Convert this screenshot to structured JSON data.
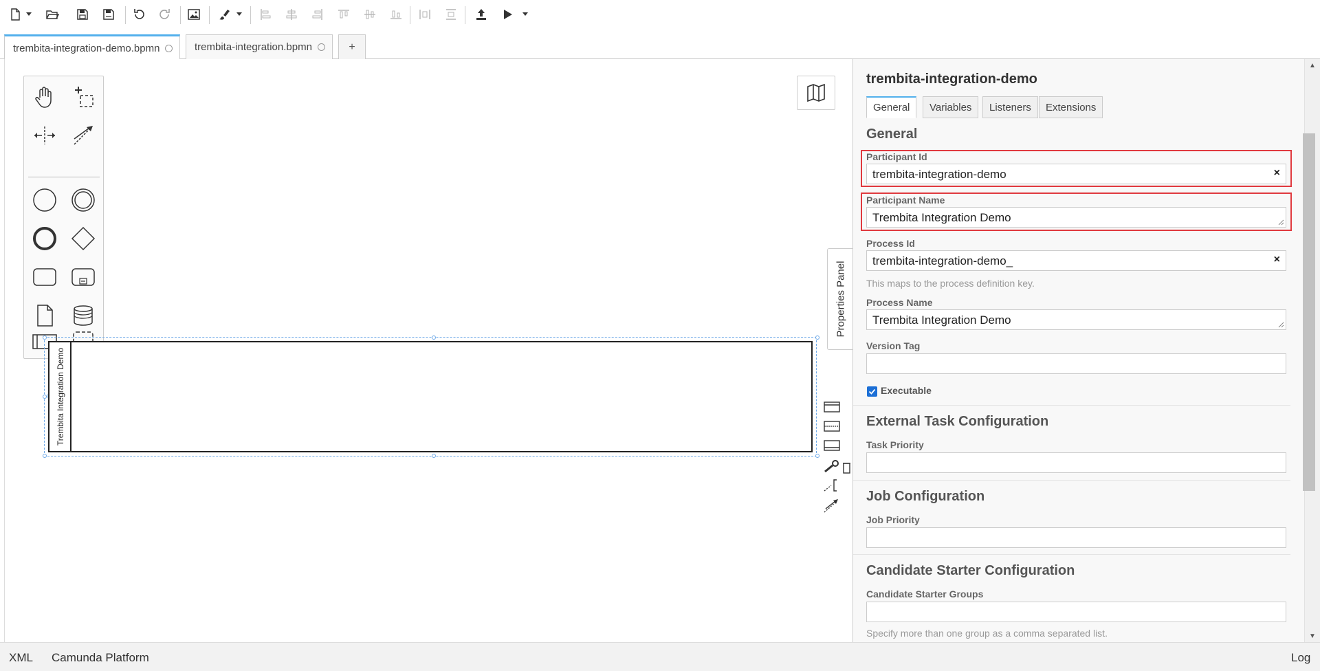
{
  "toolbar": {
    "buttons": [
      "new-file-icon",
      "open-file-icon",
      "save-icon",
      "save-as-icon",
      "undo-icon",
      "redo-icon",
      "export-image-icon",
      "color-brush-icon",
      "align-left-icon",
      "align-center-icon",
      "align-right-icon",
      "align-top-icon",
      "align-middle-icon",
      "align-bottom-icon",
      "distribute-horizontal-icon",
      "distribute-vertical-icon",
      "deploy-icon",
      "run-icon"
    ]
  },
  "tabs": [
    {
      "label": "trembita-integration-demo.bpmn",
      "active": true
    },
    {
      "label": "trembita-integration.bpmn",
      "active": false
    }
  ],
  "tab_add_label": "+",
  "canvas": {
    "pool_label": "Trembita Integration Demo"
  },
  "properties_toggle_label": "Properties Panel",
  "properties": {
    "title": "trembita-integration-demo",
    "tabs": [
      "General",
      "Variables",
      "Listeners",
      "Extensions"
    ],
    "active_tab": "General",
    "general_group_title": "General",
    "participant_id_label": "Participant Id",
    "participant_id_value": "trembita-integration-demo",
    "participant_name_label": "Participant Name",
    "participant_name_value": "Trembita Integration Demo",
    "process_id_label": "Process Id",
    "process_id_value": "trembita-integration-demo_",
    "process_id_desc": "This maps to the process definition key.",
    "process_name_label": "Process Name",
    "process_name_value": "Trembita Integration Demo",
    "version_tag_label": "Version Tag",
    "version_tag_value": "",
    "executable_label": "Executable",
    "executable_checked": true,
    "external_task_group_title": "External Task Configuration",
    "task_priority_label": "Task Priority",
    "task_priority_value": "",
    "job_group_title": "Job Configuration",
    "job_priority_label": "Job Priority",
    "job_priority_value": "",
    "candidate_group_title": "Candidate Starter Configuration",
    "candidate_groups_label": "Candidate Starter Groups",
    "candidate_groups_value": "",
    "candidate_groups_desc": "Specify more than one group as a comma separated list.",
    "clear_symbol": "×"
  },
  "statusbar": {
    "xml_label": "XML",
    "platform_label": "Camunda Platform",
    "log_label": "Log"
  },
  "colors": {
    "accent": "#52b0ec",
    "highlight": "#e0393e",
    "checkbox": "#1c6fd6",
    "selection": "#6ea9e8"
  }
}
